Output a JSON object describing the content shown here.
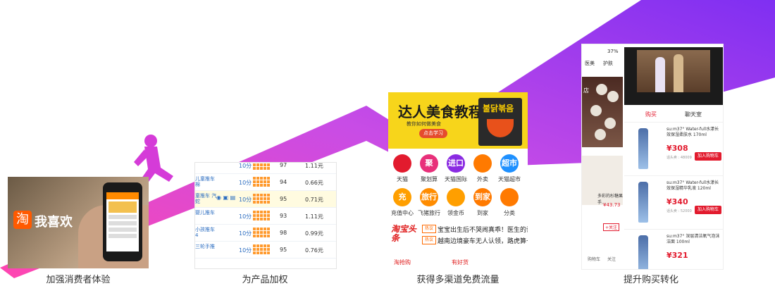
{
  "captions": [
    "加强消费者体验",
    "为产品加权",
    "获得多渠道免费流量",
    "提升购买转化"
  ],
  "colors": {
    "arrow_start": "#ff3fa4",
    "arrow_end": "#7a2cf0",
    "accent_red": "#e21b2e",
    "orange": "#ff9a2e"
  },
  "panel1": {
    "logo_char": "淘",
    "logo_text": "我喜欢",
    "icon": "hand-holding-phone-icon"
  },
  "panel2": {
    "rows": [
      {
        "name": "",
        "duration": "10分",
        "num": "97",
        "price": "1.11元",
        "highlight": false
      },
      {
        "name": "儿童推车\n棉",
        "duration": "10分",
        "num": "94",
        "price": "0.66元",
        "highlight": false
      },
      {
        "name": "童推车\n汽蛇",
        "duration": "10分",
        "num": "95",
        "price": "0.71元",
        "highlight": true
      },
      {
        "name": "婴儿推车",
        "duration": "10分",
        "num": "93",
        "price": "1.11元",
        "highlight": false
      },
      {
        "name": "小孩推车\n4",
        "duration": "10分",
        "num": "98",
        "price": "0.99元",
        "highlight": false
      },
      {
        "name": "三轮手推",
        "duration": "10分",
        "num": "95",
        "price": "0.76元",
        "highlight": false
      }
    ]
  },
  "panel3": {
    "title": "达人美食教程",
    "subtitle": "教你如何做美食",
    "button": "点击学习",
    "package_label": "불닭볶음",
    "icons": [
      {
        "glyph": "",
        "label": "天猫",
        "color": "#e21b2e"
      },
      {
        "glyph": "聚",
        "label": "聚划算",
        "color": "#e8307a"
      },
      {
        "glyph": "进口",
        "label": "天猫国际",
        "color": "#8a2be2"
      },
      {
        "glyph": "",
        "label": "外卖",
        "color": "#ff7a00"
      },
      {
        "glyph": "超市",
        "label": "天猫超市",
        "color": "#1e90ff"
      },
      {
        "glyph": "充",
        "label": "充值中心",
        "color": "#ff9f00"
      },
      {
        "glyph": "旅行",
        "label": "飞猪旅行",
        "color": "#ff8c00"
      },
      {
        "glyph": "",
        "label": "领金币",
        "color": "#ff9f00"
      },
      {
        "glyph": "到家",
        "label": "到家",
        "color": "#ff7a00"
      },
      {
        "glyph": "",
        "label": "分类",
        "color": "#ff7a00"
      }
    ],
    "news_logo": "淘宝头条",
    "news": [
      {
        "tag": "热议",
        "text": "宝宝出生后不哭闹真乖！医生的话..."
      },
      {
        "tag": "热议",
        "text": "越南边境豪车无人认领，路虎算一..."
      }
    ],
    "bottom": [
      "淘抢购",
      "有好货"
    ]
  },
  "panel4": {
    "status": "37%",
    "left_tabs": [
      "医美",
      "护肤"
    ],
    "store_label": "店",
    "tabs": [
      "购买",
      "聊天室"
    ],
    "left_price": "¥43.73",
    "left_label": "多彩的杉糖果手...",
    "follow": "+关注",
    "products": [
      {
        "name": "su:m37° Water-full水漾长效保湿柔肤水 170ml",
        "price": "¥308",
        "count": "话头卖 : 48009",
        "cart": "加入购物车"
      },
      {
        "name": "su:m37° Water-full水漾长效保湿精华乳液 120ml",
        "price": "¥340",
        "count": "话头卖 : 52000",
        "cart": "加入购物车"
      },
      {
        "name": "su:m37° 深层清洁氧气泡沫洁面 100ml",
        "price": "¥321",
        "count": "",
        "cart": ""
      }
    ],
    "bottom_nav": [
      "购物车",
      "关注"
    ]
  }
}
